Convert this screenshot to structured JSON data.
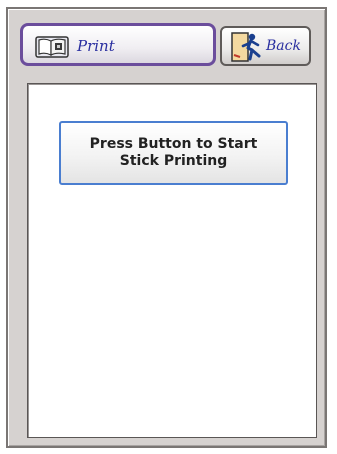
{
  "tabs": {
    "print": {
      "label": "Print",
      "icon": "print-book-icon",
      "active": true
    },
    "back": {
      "label": "Back",
      "icon": "exit-door-icon"
    }
  },
  "main": {
    "start_button_label": "Press Button to Start\nStick Printing"
  },
  "colors": {
    "active_tab_border": "#6b4d9c",
    "button_border": "#4a7ed0",
    "tab_text": "#2a2fa0",
    "frame_background": "#d6d2d0"
  }
}
